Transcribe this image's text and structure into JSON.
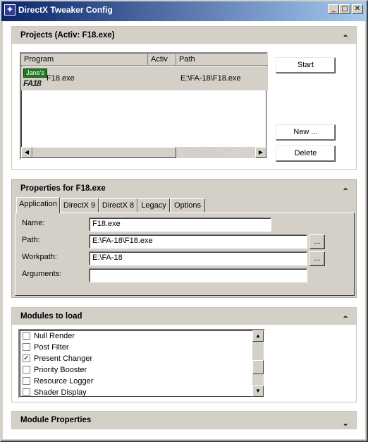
{
  "window": {
    "title": "DirectX Tweaker Config"
  },
  "projects": {
    "title": "Projects (Activ: F18.exe)",
    "columns": [
      "Program",
      "Activ",
      "Path"
    ],
    "rows": [
      {
        "program": "F18.exe",
        "activ": "",
        "path": "E:\\FA-18\\F18.exe",
        "logo_top": "Jane's",
        "logo_bottom": "FA18"
      }
    ],
    "buttons": {
      "start": "Start",
      "new": "New ...",
      "delete": "Delete"
    }
  },
  "properties": {
    "title": "Properties for F18.exe",
    "tabs": [
      "Application",
      "DirectX 9",
      "DirectX 8",
      "Legacy",
      "Options"
    ],
    "active_tab": "Application",
    "fields": {
      "name_label": "Name:",
      "name_value": "F18.exe",
      "path_label": "Path:",
      "path_value": "E:\\FA-18\\F18.exe",
      "workpath_label": "Workpath:",
      "workpath_value": "E:\\FA-18",
      "arguments_label": "Arguments:",
      "arguments_value": ""
    },
    "browse_label": "..."
  },
  "modules": {
    "title": "Modules to load",
    "items": [
      {
        "label": "Null Render",
        "checked": false
      },
      {
        "label": "Post Filter",
        "checked": false
      },
      {
        "label": "Present Changer",
        "checked": true
      },
      {
        "label": "Priority Booster",
        "checked": false
      },
      {
        "label": "Resource Logger",
        "checked": false
      },
      {
        "label": "Shader Display",
        "checked": false
      }
    ]
  },
  "module_properties": {
    "title": "Module Properties"
  },
  "icons": {
    "collapse": "chevron-double-up-icon",
    "expand": "chevron-double-down-icon",
    "minimize": "minimize-icon",
    "maximize": "maximize-icon",
    "close": "close-icon",
    "app": "directx-app-icon"
  }
}
